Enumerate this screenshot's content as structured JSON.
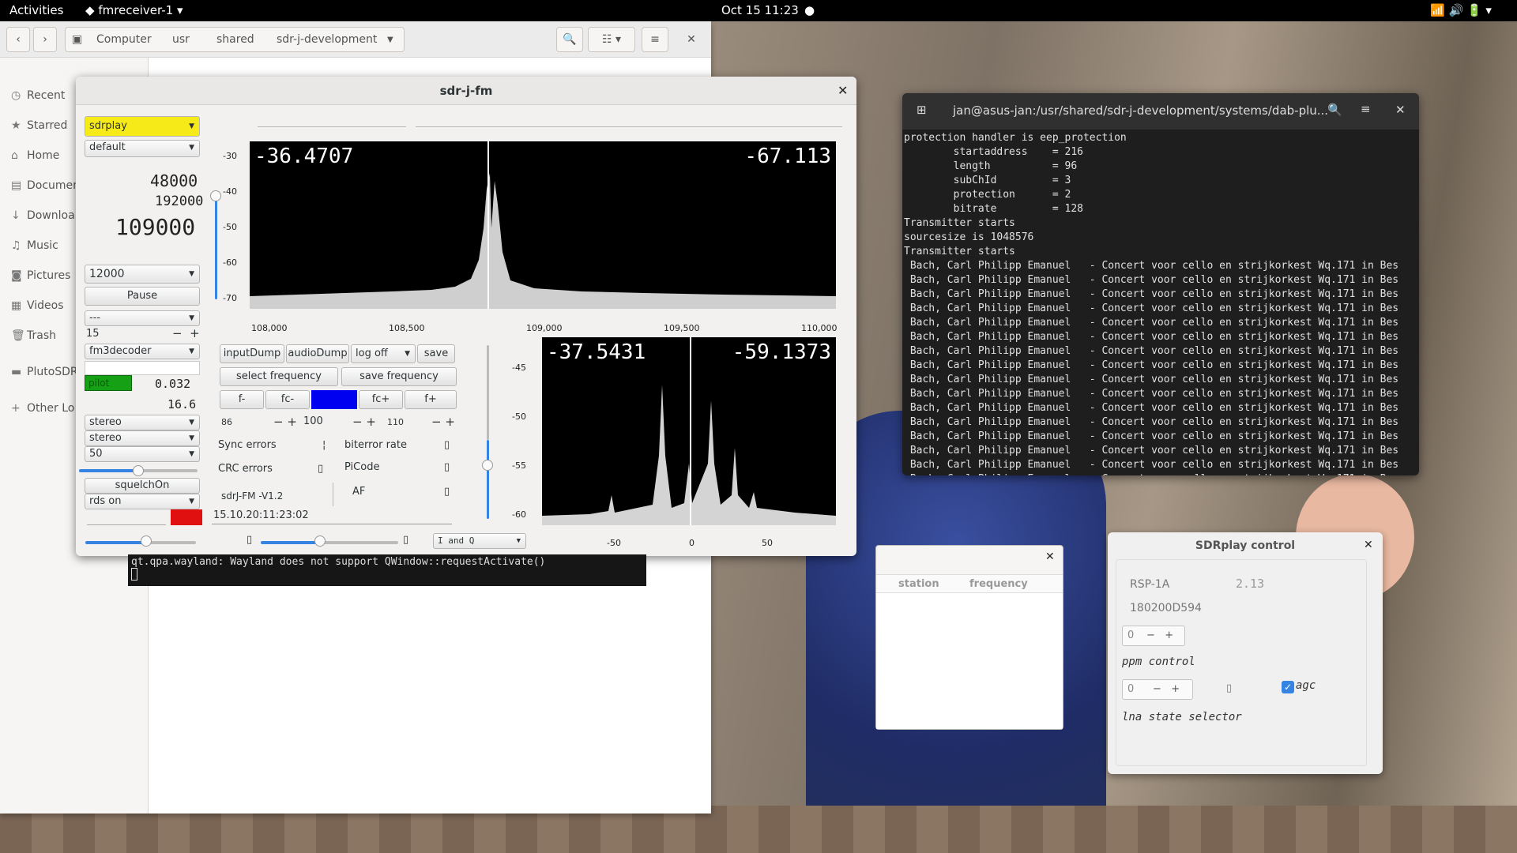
{
  "topbar": {
    "activities": "Activities",
    "app": "fmreceiver-1",
    "clock": "Oct 15  11:23"
  },
  "files": {
    "breadcrumb": [
      "Computer",
      "usr",
      "shared",
      "sdr-j-development"
    ],
    "sidebar": [
      "Recent",
      "Starred",
      "Home",
      "Documen",
      "Downloa",
      "Music",
      "Pictures",
      "Videos",
      "Trash",
      "PlutoSDR",
      "Other Lo"
    ]
  },
  "sdr": {
    "title": "sdr-j-fm",
    "device": "sdrplay",
    "profile": "default",
    "rate1": "48000",
    "rate2": "192000",
    "frequency": "109000",
    "band": "12000",
    "pause": "Pause",
    "mode": "---",
    "step": "15",
    "decoder": "fm3decoder",
    "pilot": "pilot",
    "val1": "0.032",
    "val2": "16.6",
    "stereo1": "stereo",
    "stereo2": "stereo",
    "fifty": "50",
    "squelch": "squelchOn",
    "rds": "rds on",
    "spectrum": {
      "left_value": "-36.4707",
      "right_value": "-67.113",
      "y_ticks": [
        "-30",
        "-40",
        "-50",
        "-60",
        "-70"
      ],
      "x_ticks": [
        "108,000",
        "108,500",
        "109,000",
        "109,500",
        "110,000"
      ]
    },
    "buttons": {
      "input_dump": "inputDump",
      "audio_dump": "audioDump",
      "log": "log off",
      "save": "save",
      "select_freq": "select frequency",
      "save_freq": "save frequency",
      "f_minus": "f-",
      "fc_minus": "fc-",
      "fc_plus": "fc+",
      "f_plus": "f+"
    },
    "steps": {
      "a": "86",
      "b": "100",
      "c": "110"
    },
    "labels": {
      "sync": "Sync errors",
      "crc": "CRC errors",
      "biterror": "biterror rate",
      "picode": "PiCode",
      "af": "AF",
      "version": "sdrJ-FM -V1.2",
      "timestamp": "15.10.20:11:23:02"
    },
    "iq": "I and Q",
    "scope2": {
      "left_value": "-37.5431",
      "right_value": "-59.1373",
      "y_ticks": [
        "-45",
        "-50",
        "-55",
        "-60"
      ],
      "x_ticks": [
        "-50",
        "0",
        "50"
      ]
    }
  },
  "qt_message": "qt.qpa.wayland: Wayland does not support QWindow::requestActivate()",
  "terminal": {
    "title": "jan@asus-jan:/usr/shared/sdr-j-development/systems/dab-plu...",
    "lines": [
      "protection handler is eep_protection",
      "        startaddress    = 216",
      "        length          = 96",
      "        subChId         = 3",
      "        protection      = 2",
      "        bitrate         = 128",
      "Transmitter starts",
      "sourcesize is 1048576",
      "Transmitter starts",
      " Bach, Carl Philipp Emanuel   - Concert voor cello en strijkorkest Wq.171 in Bes",
      " Bach, Carl Philipp Emanuel   - Concert voor cello en strijkorkest Wq.171 in Bes",
      " Bach, Carl Philipp Emanuel   - Concert voor cello en strijkorkest Wq.171 in Bes",
      " Bach, Carl Philipp Emanuel   - Concert voor cello en strijkorkest Wq.171 in Bes",
      " Bach, Carl Philipp Emanuel   - Concert voor cello en strijkorkest Wq.171 in Bes",
      " Bach, Carl Philipp Emanuel   - Concert voor cello en strijkorkest Wq.171 in Bes",
      " Bach, Carl Philipp Emanuel   - Concert voor cello en strijkorkest Wq.171 in Bes",
      " Bach, Carl Philipp Emanuel   - Concert voor cello en strijkorkest Wq.171 in Bes",
      " Bach, Carl Philipp Emanuel   - Concert voor cello en strijkorkest Wq.171 in Bes",
      " Bach, Carl Philipp Emanuel   - Concert voor cello en strijkorkest Wq.171 in Bes",
      " Bach, Carl Philipp Emanuel   - Concert voor cello en strijkorkest Wq.171 in Bes",
      " Bach, Carl Philipp Emanuel   - Concert voor cello en strijkorkest Wq.171 in Bes",
      " Bach, Carl Philipp Emanuel   - Concert voor cello en strijkorkest Wq.171 in Bes",
      " Bach, Carl Philipp Emanuel   - Concert voor cello en strijkorkest Wq.171 in Bes",
      " Bach, Carl Philipp Emanuel   - Concert voor cello en strijkorkest Wq.171 in Bes",
      " Bach, Carl Philipp Emanuel   - Concert voor cello en strijkorkest Wq.171 in Bes"
    ]
  },
  "stations": {
    "col_station": "station",
    "col_frequency": "frequency"
  },
  "sdrplay": {
    "title": "SDRplay control",
    "model": "RSP-1A",
    "version": "2.13",
    "serial": "180200D594",
    "ppm_value": "0",
    "ppm_label": "ppm control",
    "lna_value": "0",
    "agc": "agc",
    "lna_label": "lna state selector"
  }
}
